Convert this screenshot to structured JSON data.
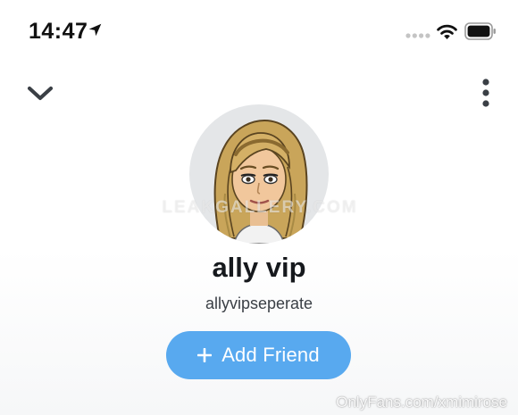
{
  "status_bar": {
    "time": "14:47",
    "icons": [
      "location-arrow-icon",
      "signal-dots-icon",
      "wifi-icon",
      "battery-icon"
    ]
  },
  "nav": {
    "collapse_icon": "chevron-down-icon",
    "more_icon": "more-vertical-icon"
  },
  "profile": {
    "avatar": "bitmoji-avatar",
    "display_name": "ally vip",
    "username": "allyvipseperate"
  },
  "actions": {
    "add_friend_label": "Add Friend",
    "add_friend_icon": "plus-icon"
  },
  "watermarks": {
    "center": "LEAKGALLERY.COM",
    "corner": "OnlyFans.com/xmimirose"
  },
  "colors": {
    "accent_blue": "#58a9ef",
    "text_dark": "#16191d",
    "avatar_bg": "#e4e6e8"
  }
}
